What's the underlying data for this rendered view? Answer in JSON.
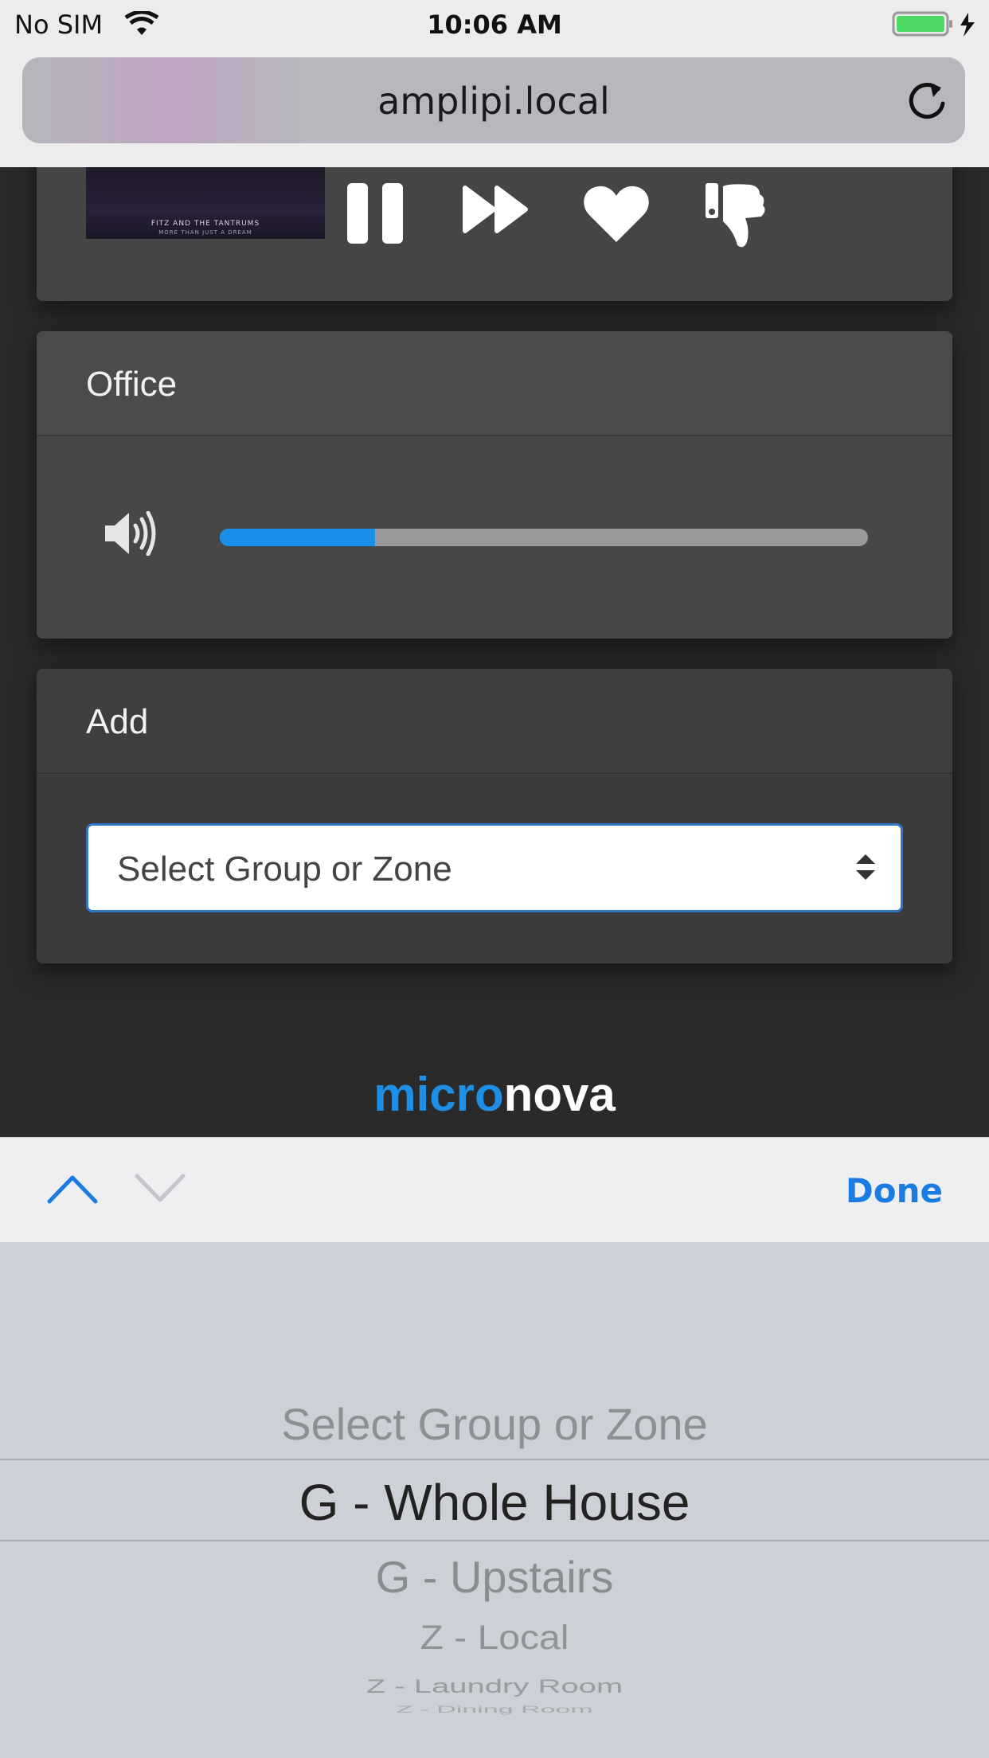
{
  "status_bar": {
    "carrier": "No SIM",
    "time": "10:06 AM"
  },
  "browser": {
    "url": "amplipi.local"
  },
  "now_playing": {
    "album_art_text": "FITZ AND THE TANTRUMS",
    "album_art_subtext": "MORE THAN JUST A DREAM"
  },
  "office_card": {
    "title": "Office",
    "volume": 0.24
  },
  "add_card": {
    "title": "Add",
    "select_value": "Select Group or Zone"
  },
  "logo": {
    "part1": "micro",
    "part2": "nova"
  },
  "toolbar": {
    "done_label": "Done"
  },
  "picker": {
    "options": [
      "Select Group or Zone",
      "G - Whole House",
      "G - Upstairs",
      "Z - Local",
      "Z - Laundry Room",
      "Z - Dining Room"
    ],
    "selected_index": 1
  },
  "colors": {
    "accent": "#1a8fea",
    "done": "#1a7ce0",
    "card": "#4a4a4a"
  }
}
